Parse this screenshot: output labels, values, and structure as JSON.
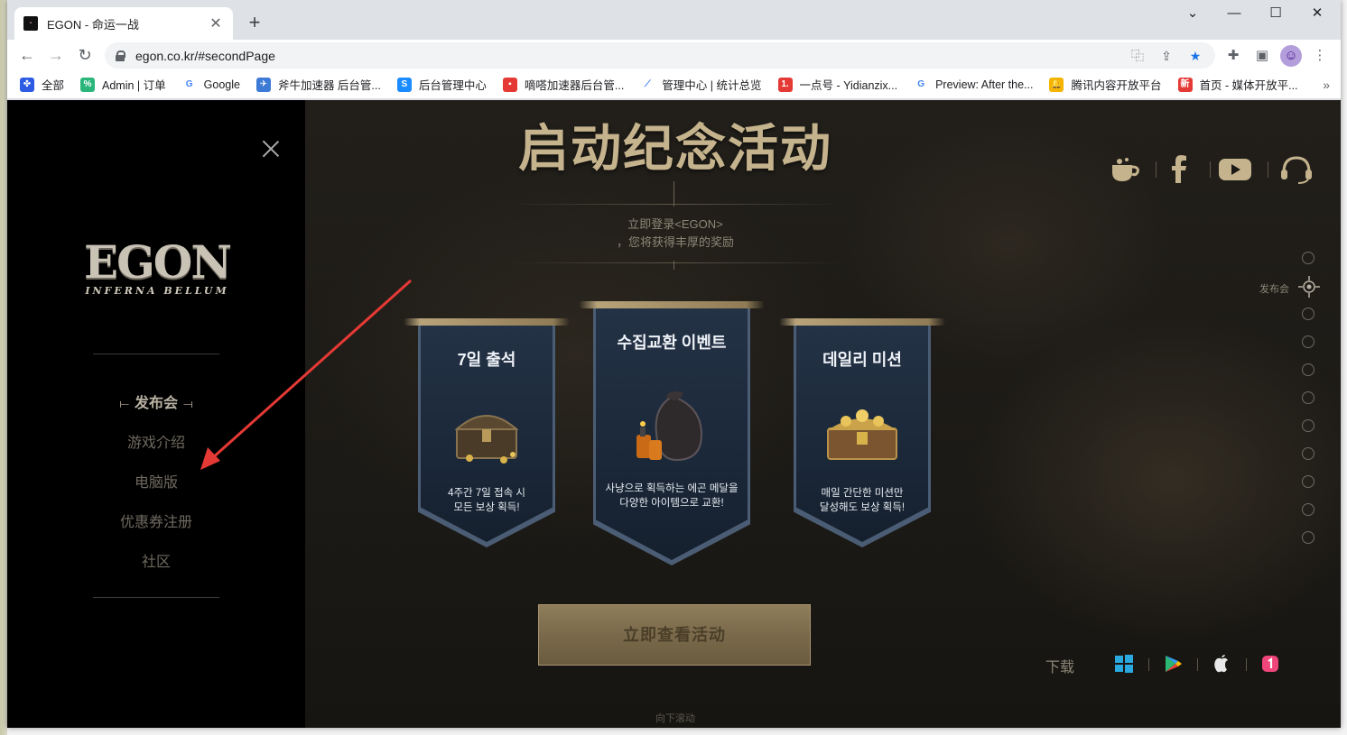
{
  "browser": {
    "tab_title": "EGON - 命运一战",
    "tab_close": "✕",
    "new_tab": "+",
    "url": "egon.co.kr/#secondPage",
    "win_minimize": "⌄",
    "win_min": "—",
    "win_max": "☐",
    "win_close": "✕"
  },
  "bookmarks": [
    {
      "label": "全部",
      "icon": "baidu-paw-icon",
      "color": "#2d5be3",
      "glyph": "✤"
    },
    {
      "label": "Admin | 订单",
      "icon": "admin-icon",
      "color": "#2ab57a",
      "glyph": "%"
    },
    {
      "label": "Google",
      "icon": "google-icon",
      "color": "#ffffff",
      "glyph": "G"
    },
    {
      "label": "斧牛加速器 后台管...",
      "icon": "axe-icon",
      "color": "#3d7ad6",
      "glyph": "✈"
    },
    {
      "label": "后台管理中心",
      "icon": "s-logo-icon",
      "color": "#1a8cff",
      "glyph": "S"
    },
    {
      "label": "嘀嗒加速器后台管...",
      "icon": "red-square-icon",
      "color": "#e53935",
      "glyph": "▪"
    },
    {
      "label": "管理中心 | 统计总览",
      "icon": "chart-line-icon",
      "color": "#ffffff",
      "glyph": "⟋"
    },
    {
      "label": "一点号 - Yidianzix...",
      "icon": "yidian-icon",
      "color": "#e53935",
      "glyph": "1."
    },
    {
      "label": "Preview: After the...",
      "icon": "google-icon",
      "color": "#ffffff",
      "glyph": "G"
    },
    {
      "label": "腾讯内容开放平台",
      "icon": "bell-icon",
      "color": "#f5b400",
      "glyph": "🔔"
    },
    {
      "label": "首页 - 媒体开放平...",
      "icon": "media-icon",
      "color": "#e53935",
      "glyph": "新"
    }
  ],
  "bookmarks_more": "»",
  "sidebar": {
    "logo_main": "EGON",
    "logo_sub": "INFERNA BELLUM",
    "menu": [
      {
        "label": "发布会",
        "active": true
      },
      {
        "label": "游戏介绍",
        "active": false
      },
      {
        "label": "电脑版",
        "active": false
      },
      {
        "label": "优惠券注册",
        "active": false
      },
      {
        "label": "社区",
        "active": false
      }
    ],
    "deco_left": "⟝",
    "deco_right": "⟞"
  },
  "main": {
    "title": "启动纪念活动",
    "subtitle_line1": "立即登录<EGON>",
    "subtitle_line2": "，您将获得丰厚的奖励",
    "banners": [
      {
        "title": "7일 출석",
        "desc_line1": "4주간 7일 접속 시",
        "desc_line2": "모든 보상 획득!",
        "art": "treasure-chest-icon"
      },
      {
        "title": "수집교환 이벤트",
        "desc_line1": "사냥으로 획득하는 에곤 메달을",
        "desc_line2": "다양한 아이템으로 교환!",
        "art": "loot-bag-icon"
      },
      {
        "title": "데일리 미션",
        "desc_line1": "매일 간단한 미션만",
        "desc_line2": "달성해도 보상 획득!",
        "art": "gold-chest-icon"
      }
    ],
    "cta_label": "立即查看活动",
    "scroll_hint": "向下滚动",
    "dotnav_active_label": "发布会",
    "download_label": "下载"
  },
  "colors": {
    "accent_gold": "#c5b38d",
    "banner_navy": "#1b2839",
    "arrow_red": "#e53935"
  }
}
